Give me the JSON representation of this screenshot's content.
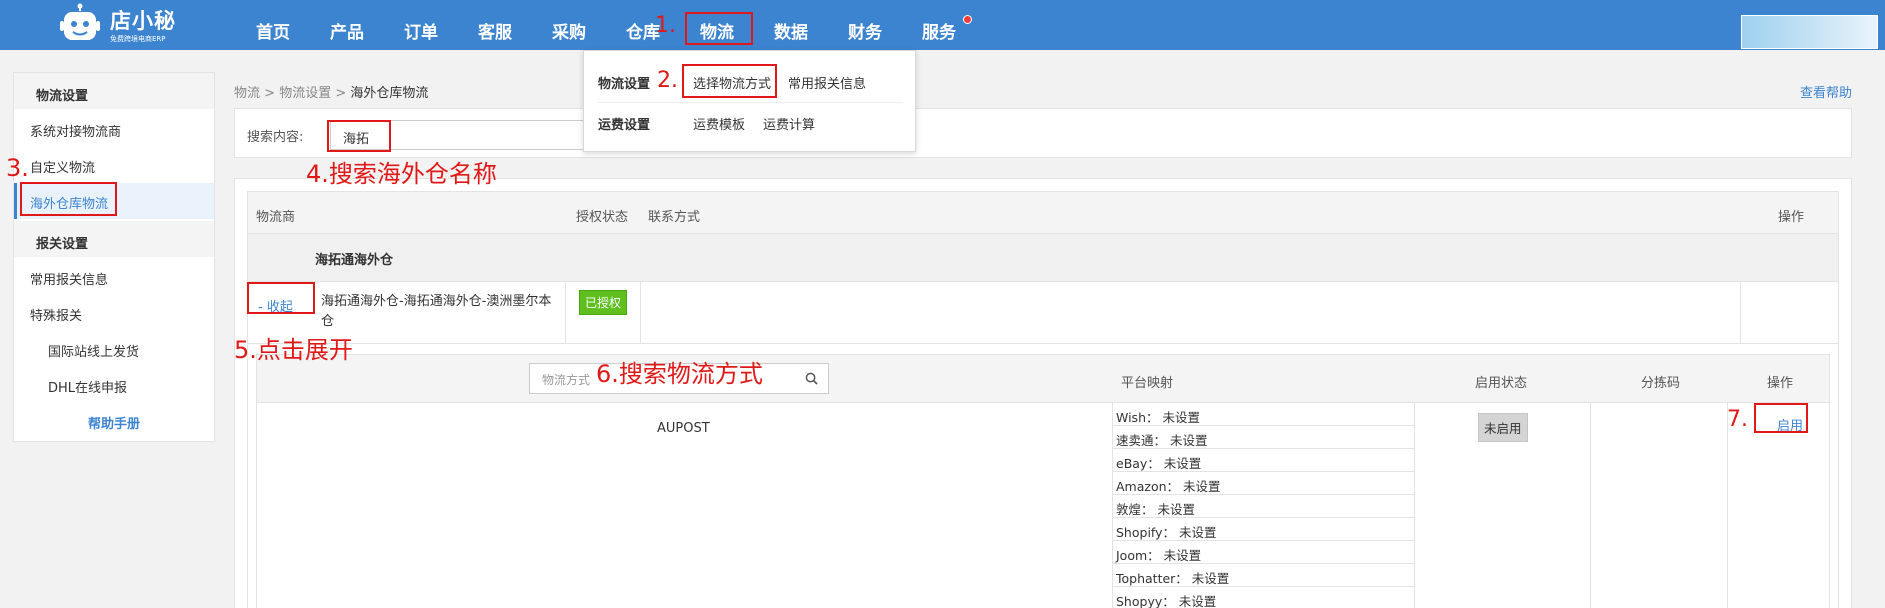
{
  "brand": {
    "name": "店小秘",
    "tagline": "免费跨境电商ERP"
  },
  "nav": [
    "首页",
    "产品",
    "订单",
    "客服",
    "采购",
    "仓库",
    "物流",
    "数据",
    "财务",
    "服务"
  ],
  "dropdown": {
    "rows": [
      {
        "head": "物流设置",
        "items": [
          "选择物流方式",
          "常用报关信息"
        ]
      },
      {
        "head": "运费设置",
        "items": [
          "运费模板",
          "运费计算"
        ]
      }
    ]
  },
  "sidebar": {
    "sec1": "物流设置",
    "items1": [
      "系统对接物流商",
      "自定义物流",
      "海外仓库物流"
    ],
    "sec2": "报关设置",
    "items2": [
      "常用报关信息",
      "特殊报关"
    ],
    "sub2": [
      "国际站线上发货",
      "DHL在线申报"
    ],
    "help": "帮助手册"
  },
  "breadcrumb": {
    "a": "物流",
    "b": "物流设置",
    "cur": "海外仓库物流",
    "sep": ">"
  },
  "help_link": "查看帮助",
  "search": {
    "label": "搜索内容:",
    "value": "海拓"
  },
  "table": {
    "headers": [
      "物流商",
      "授权状态",
      "联系方式",
      "操作"
    ],
    "group": "海拓通海外仓",
    "row": {
      "toggle": "- 收起",
      "name": "海拓通海外仓-海拓通海外仓-澳洲墨尔本仓",
      "auth": "已授权"
    },
    "sub": {
      "search_placeholder": "物流方式",
      "headers": [
        "平台映射",
        "启用状态",
        "分拣码",
        "操作"
      ],
      "service": "AUPOST",
      "platforms": [
        "Wish：  未设置",
        "速卖通：  未设置",
        "eBay：  未设置",
        "Amazon：  未设置",
        "敦煌：  未设置",
        "Shopify：  未设置",
        "Joom：  未设置",
        "Tophatter：  未设置",
        "Shopyy：  未设置"
      ],
      "status": "未启用",
      "action": "启用"
    }
  },
  "annotations": [
    "1.",
    "2.",
    "3.",
    "4.搜索海外仓名称",
    "5.点击展开",
    "6.搜索物流方式",
    "7."
  ],
  "colors": {
    "primary": "#3c84cf",
    "annotation": "#e01818",
    "authorized": "#5fbf1f"
  }
}
